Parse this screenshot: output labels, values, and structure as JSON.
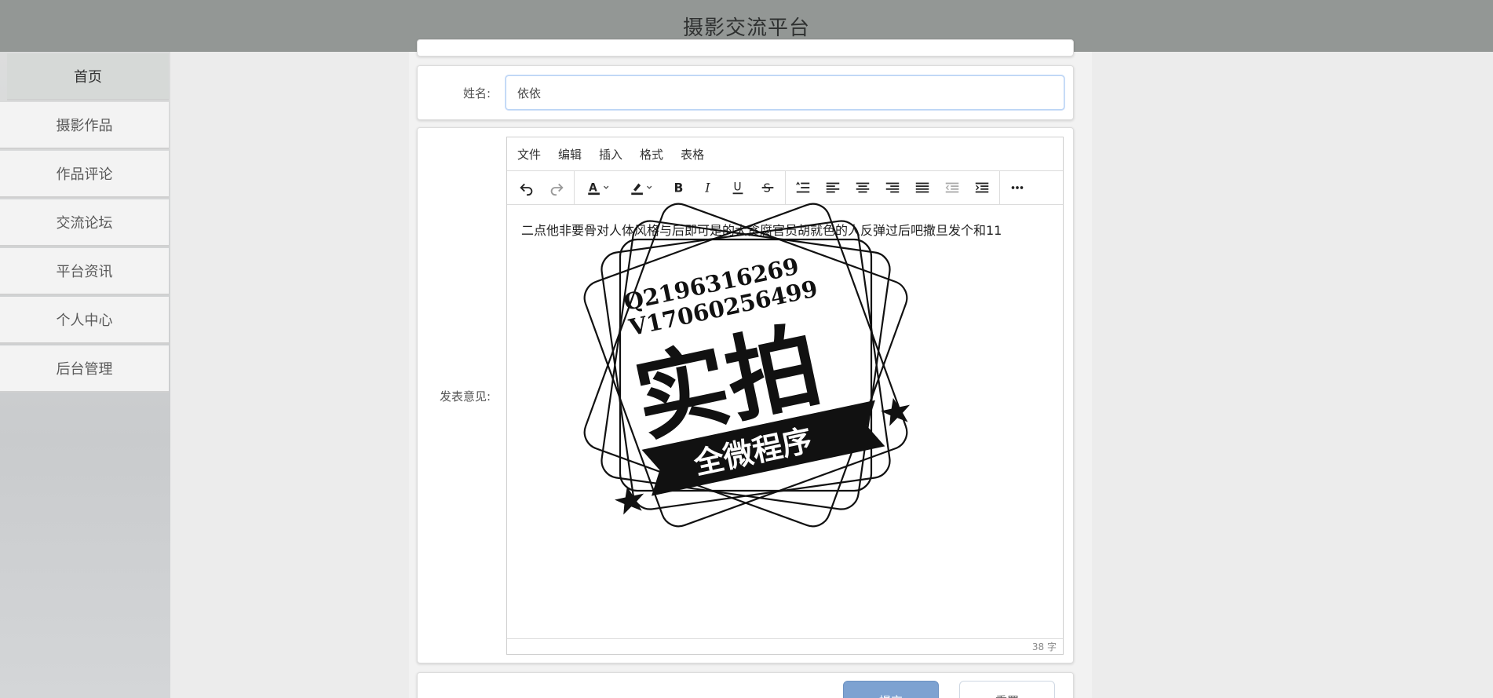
{
  "header": {
    "title": "摄影交流平台"
  },
  "sidebar": {
    "items": [
      {
        "label": "首页",
        "active": true
      },
      {
        "label": "摄影作品"
      },
      {
        "label": "作品评论"
      },
      {
        "label": "交流论坛"
      },
      {
        "label": "平台资讯"
      },
      {
        "label": "个人中心"
      },
      {
        "label": "后台管理"
      }
    ]
  },
  "form": {
    "name": {
      "label": "姓名:",
      "value": "依依"
    },
    "opinion": {
      "label": "发表意见:"
    }
  },
  "editor": {
    "menu": [
      "文件",
      "编辑",
      "插入",
      "格式",
      "表格"
    ],
    "content": "二点他非要骨对人体风格与后即可是的大贪腐官员胡就色的人反弹过后吧撒旦发个和11",
    "word_count": "38 字",
    "toolbar_icons": [
      "undo-icon",
      "redo-icon",
      "text-color-icon",
      "highlight-icon",
      "bold-icon",
      "italic-icon",
      "underline-icon",
      "strikethrough-icon",
      "line-height-icon",
      "align-left-icon",
      "align-center-icon",
      "align-right-icon",
      "align-justify-icon",
      "outdent-icon",
      "indent-icon",
      "more-icon"
    ]
  },
  "watermark": {
    "line1": "Q2196316269",
    "line2": "V17060256499",
    "main": "实拍",
    "banner": "全微程序"
  },
  "buttons": {
    "submit": "提交",
    "reset": "重置"
  }
}
